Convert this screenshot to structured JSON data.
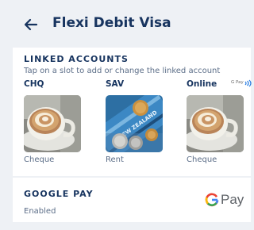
{
  "header": {
    "title": "Flexi Debit Visa",
    "back_icon": "arrow-left-icon"
  },
  "linked_accounts": {
    "heading": "LINKED ACCOUNTS",
    "hint": "Tap on a slot to add or change the linked account",
    "slots": [
      {
        "label": "CHQ",
        "account": "Cheque",
        "image": "coffee-latte"
      },
      {
        "label": "SAV",
        "account": "Rent",
        "image": "nz-banknotes-coins"
      },
      {
        "label": "Online",
        "account": "Cheque",
        "image": "coffee-latte",
        "badge": "G Pay",
        "badge_icon": "contactless-icon"
      }
    ]
  },
  "google_pay": {
    "heading": "GOOGLE PAY",
    "status": "Enabled",
    "logo_text": "Pay",
    "logo_letter": "G"
  },
  "colors": {
    "background": "#eef1f5",
    "card": "#ffffff",
    "title": "#17345f",
    "secondary_text": "#5c6e88",
    "accent_blue": "#2a7de1"
  }
}
